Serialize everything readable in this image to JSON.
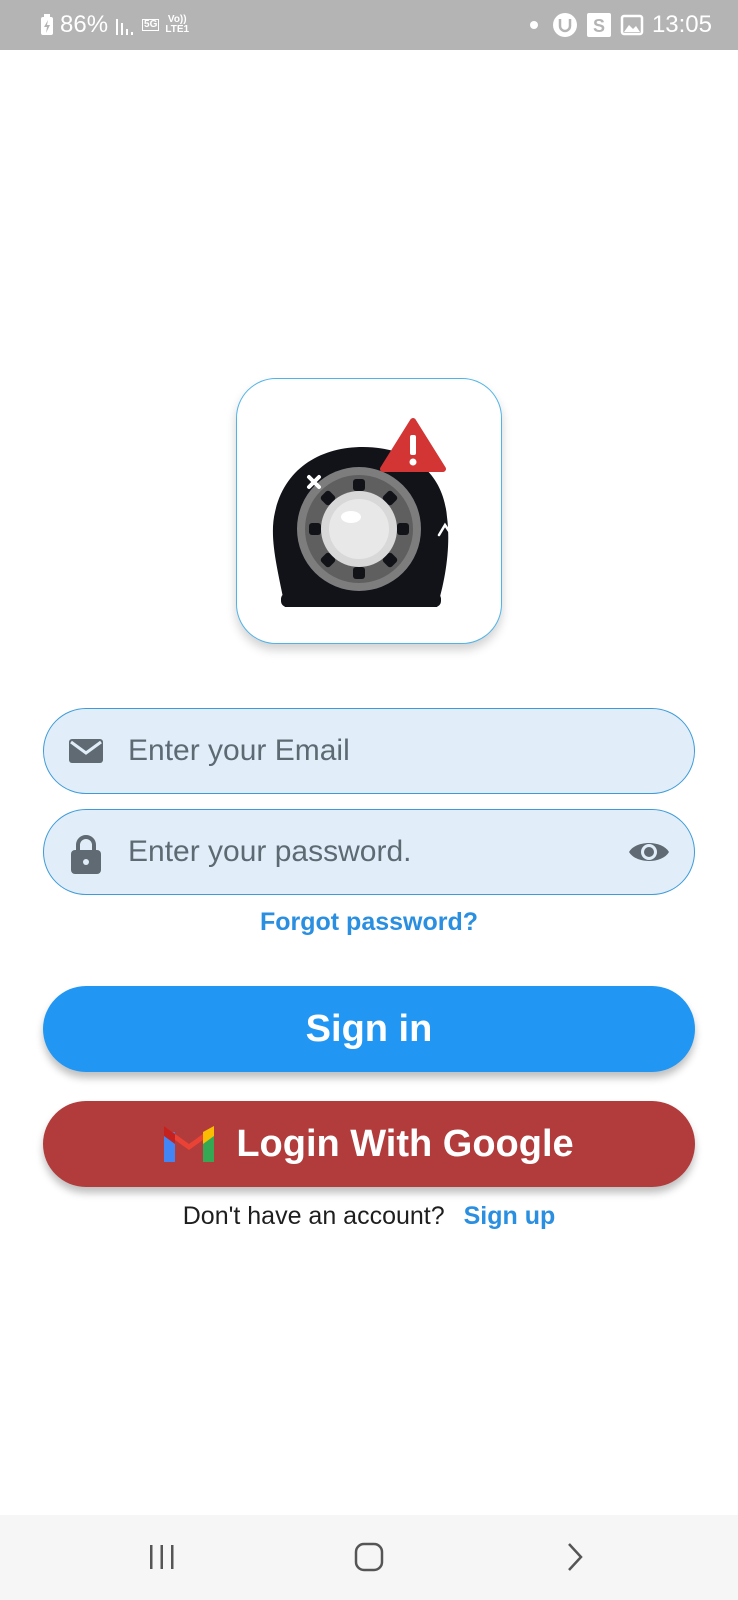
{
  "status_bar": {
    "battery": "86%",
    "network_5g": "5G",
    "volte_top": "Vo))",
    "volte_bottom": "LTE1",
    "time": "13:05"
  },
  "login": {
    "email_placeholder": "Enter your Email",
    "password_placeholder": "Enter your password.",
    "forgot_label": "Forgot password?",
    "signin_label": "Sign in",
    "google_label": "Login With Google",
    "no_account_text": "Don't have an account?",
    "signup_label": "Sign up"
  },
  "colors": {
    "primary": "#2196f3",
    "google_button": "#b23c3c",
    "link": "#2a8fe0",
    "field_bg": "#e1eef9"
  },
  "icons": [
    "battery-charging-icon",
    "signal-icon",
    "u-app-icon",
    "s-app-icon",
    "gallery-icon",
    "mail-icon",
    "lock-icon",
    "eye-icon",
    "gmail-icon",
    "recent-apps-icon",
    "home-icon",
    "back-icon"
  ]
}
